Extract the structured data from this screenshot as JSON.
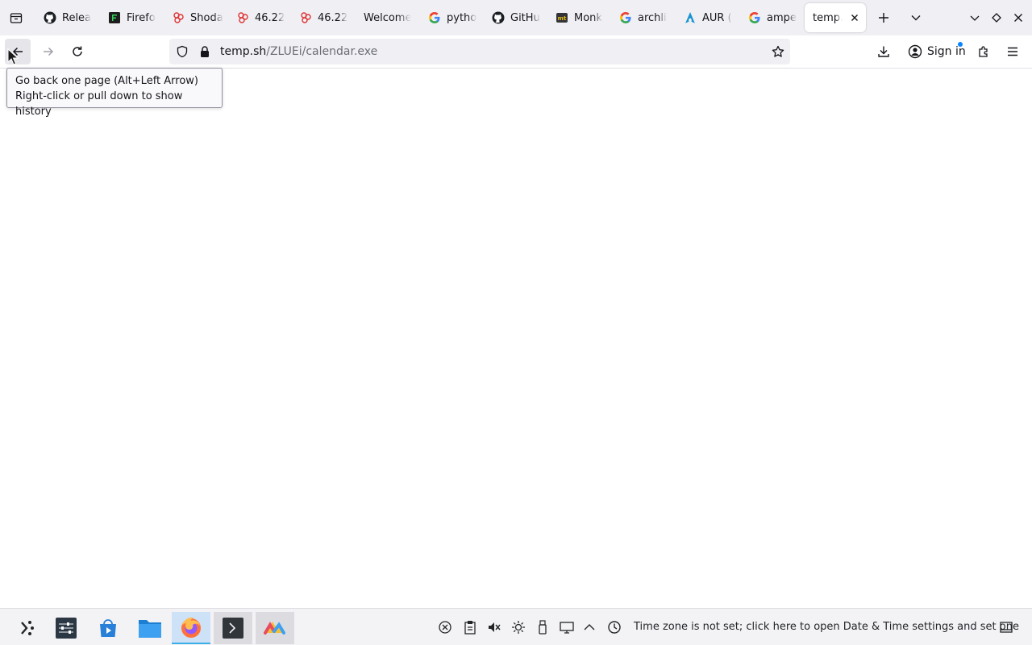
{
  "tabs": [
    {
      "label": "Relea",
      "icon": "github-icon"
    },
    {
      "label": "Firefo",
      "icon": "terminal-green-icon"
    },
    {
      "label": "Shoda",
      "icon": "shodan-icon"
    },
    {
      "label": "46.22",
      "icon": "shodan-icon"
    },
    {
      "label": "46.22",
      "icon": "shodan-icon"
    },
    {
      "label": "Welcome",
      "icon": ""
    },
    {
      "label": "pytho",
      "icon": "google-icon"
    },
    {
      "label": "GitHu",
      "icon": "github-icon"
    },
    {
      "label": "Monk",
      "icon": "monkeytype-icon"
    },
    {
      "label": "archli",
      "icon": "google-icon"
    },
    {
      "label": "AUR (",
      "icon": "arch-icon"
    },
    {
      "label": "ampe",
      "icon": "google-icon"
    },
    {
      "label": "temp.s",
      "icon": "",
      "active": true
    }
  ],
  "urlbar": {
    "host": "temp.sh",
    "path": "/ZLUEi/calendar.exe"
  },
  "toolbar": {
    "sign_in_label": "Sign in"
  },
  "tooltip": {
    "line1": "Go back one page (Alt+Left Arrow)",
    "line2": "Right-click or pull down to show history"
  },
  "taskbar": {
    "apps": [
      "application-launcher-icon",
      "system-settings-icon",
      "discover-store-icon",
      "file-manager-icon",
      "firefox-icon",
      "terminal-icon",
      "app-icon"
    ],
    "tray_icons": [
      "network-icon",
      "clipboard-icon",
      "volume-muted-icon",
      "brightness-icon",
      "usb-icon",
      "display-icon",
      "expand-tray-icon",
      "clock-icon"
    ],
    "clock_text": "Time zone is not set; click here to open Date & Time settings and set one"
  },
  "colors": {
    "accent": "#0a84ff",
    "tabstrip_bg": "#f0f0f4",
    "taskbar_active": "#3daee9"
  }
}
